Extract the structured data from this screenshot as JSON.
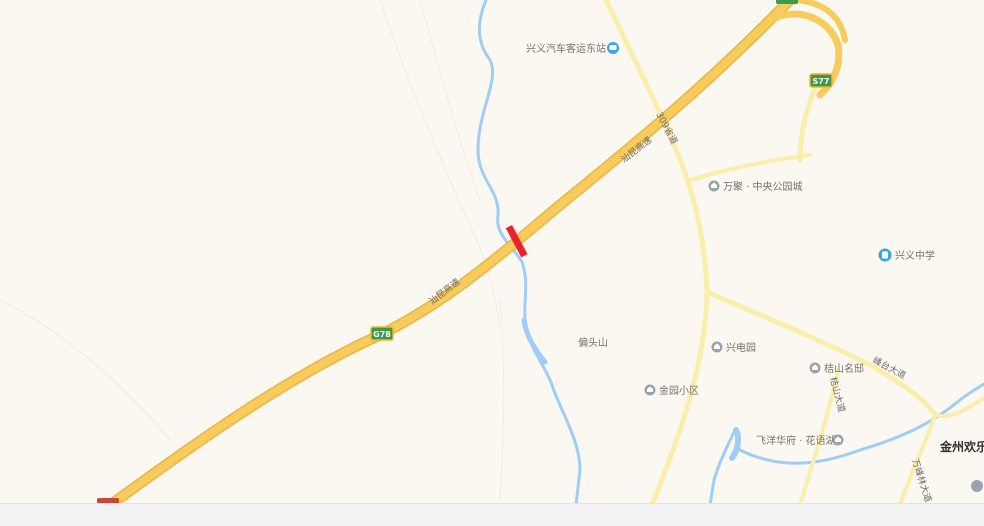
{
  "map": {
    "pois": [
      {
        "key": "bus_station",
        "name": "兴义汽车客运东站",
        "icon": "bus-station-icon",
        "color": "#3aa6e8"
      },
      {
        "key": "wanju",
        "name": "万聚 · 中央公园城",
        "icon": "residential-icon",
        "color": "#9aa3ad"
      },
      {
        "key": "school",
        "name": "兴义中学",
        "icon": "school-icon",
        "color": "#3aa6e8"
      },
      {
        "key": "mountain",
        "name": "偏头山",
        "icon": "",
        "color": ""
      },
      {
        "key": "xingdian",
        "name": "兴电园",
        "icon": "residential-icon",
        "color": "#9aa3ad"
      },
      {
        "key": "jinyuan",
        "name": "金园小区",
        "icon": "residential-icon",
        "color": "#9aa3ad"
      },
      {
        "key": "jieshan",
        "name": "桔山名邸",
        "icon": "residential-icon",
        "color": "#9aa3ad"
      },
      {
        "key": "feiyang",
        "name": "飞洋华府 · 花语湖",
        "icon": "residential-icon",
        "color": "#9aa3ad"
      },
      {
        "key": "jinzhou",
        "name": "金州欢乐",
        "icon": "",
        "color": ""
      }
    ],
    "road_labels": {
      "expressway_upper": "汕昆高速",
      "expressway_lower": "汕昆高速",
      "provincial": "309省道",
      "fengtai": "峰台大道",
      "jieshan_ave": "桔山大道",
      "wanfeng_ave": "万峰林大道"
    },
    "shields": {
      "g78": "G78",
      "s77": "S77"
    },
    "colors": {
      "background": "#fbf8f1",
      "expressway": "#f7cb5c",
      "arterial": "#fbedaa",
      "river": "#9fcdf5",
      "incident": "#e8232b",
      "shield": "#3a9a4b"
    }
  }
}
